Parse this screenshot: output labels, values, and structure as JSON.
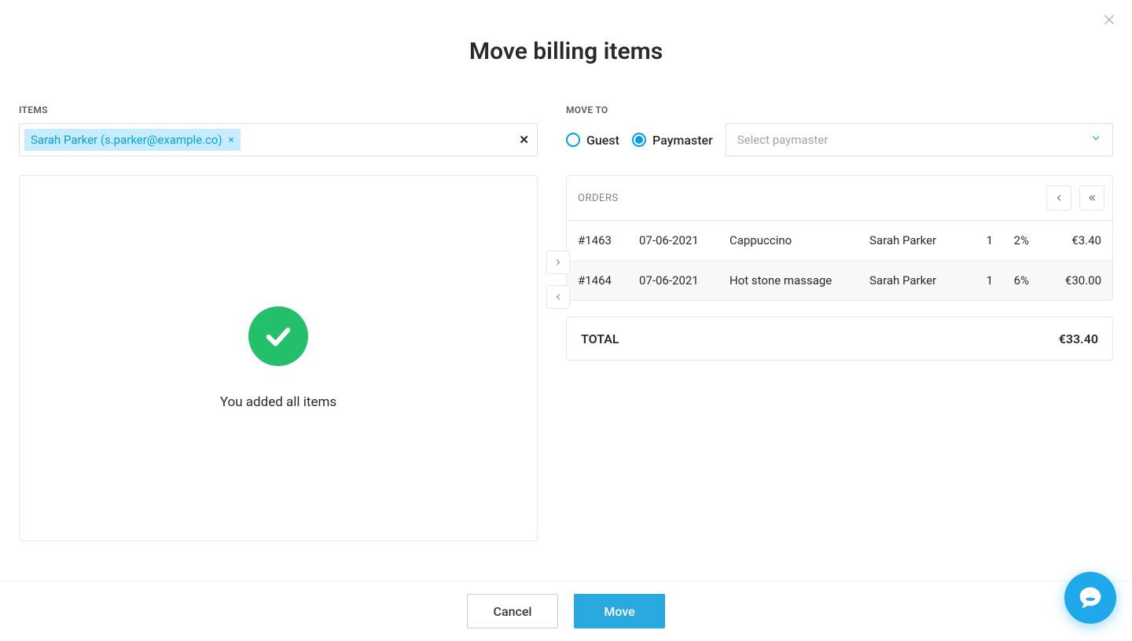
{
  "title": "Move billing items",
  "items": {
    "label": "ITEMS",
    "token": "Sarah Parker (s.parker@example.co)",
    "empty_message": "You added all items"
  },
  "move_to": {
    "label": "MOVE TO",
    "option_guest": "Guest",
    "option_paymaster": "Paymaster",
    "selected": "paymaster",
    "select_placeholder": "Select paymaster"
  },
  "orders": {
    "header": "ORDERS",
    "rows": [
      {
        "id": "#1463",
        "date": "07-06-2021",
        "item": "Cappuccino",
        "guest": "Sarah Parker",
        "qty": "1",
        "tax": "2%",
        "amount": "€3.40"
      },
      {
        "id": "#1464",
        "date": "07-06-2021",
        "item": "Hot stone massage",
        "guest": "Sarah Parker",
        "qty": "1",
        "tax": "6%",
        "amount": "€30.00"
      }
    ]
  },
  "total": {
    "label": "TOTAL",
    "amount": "€33.40"
  },
  "footer": {
    "cancel": "Cancel",
    "move": "Move"
  }
}
